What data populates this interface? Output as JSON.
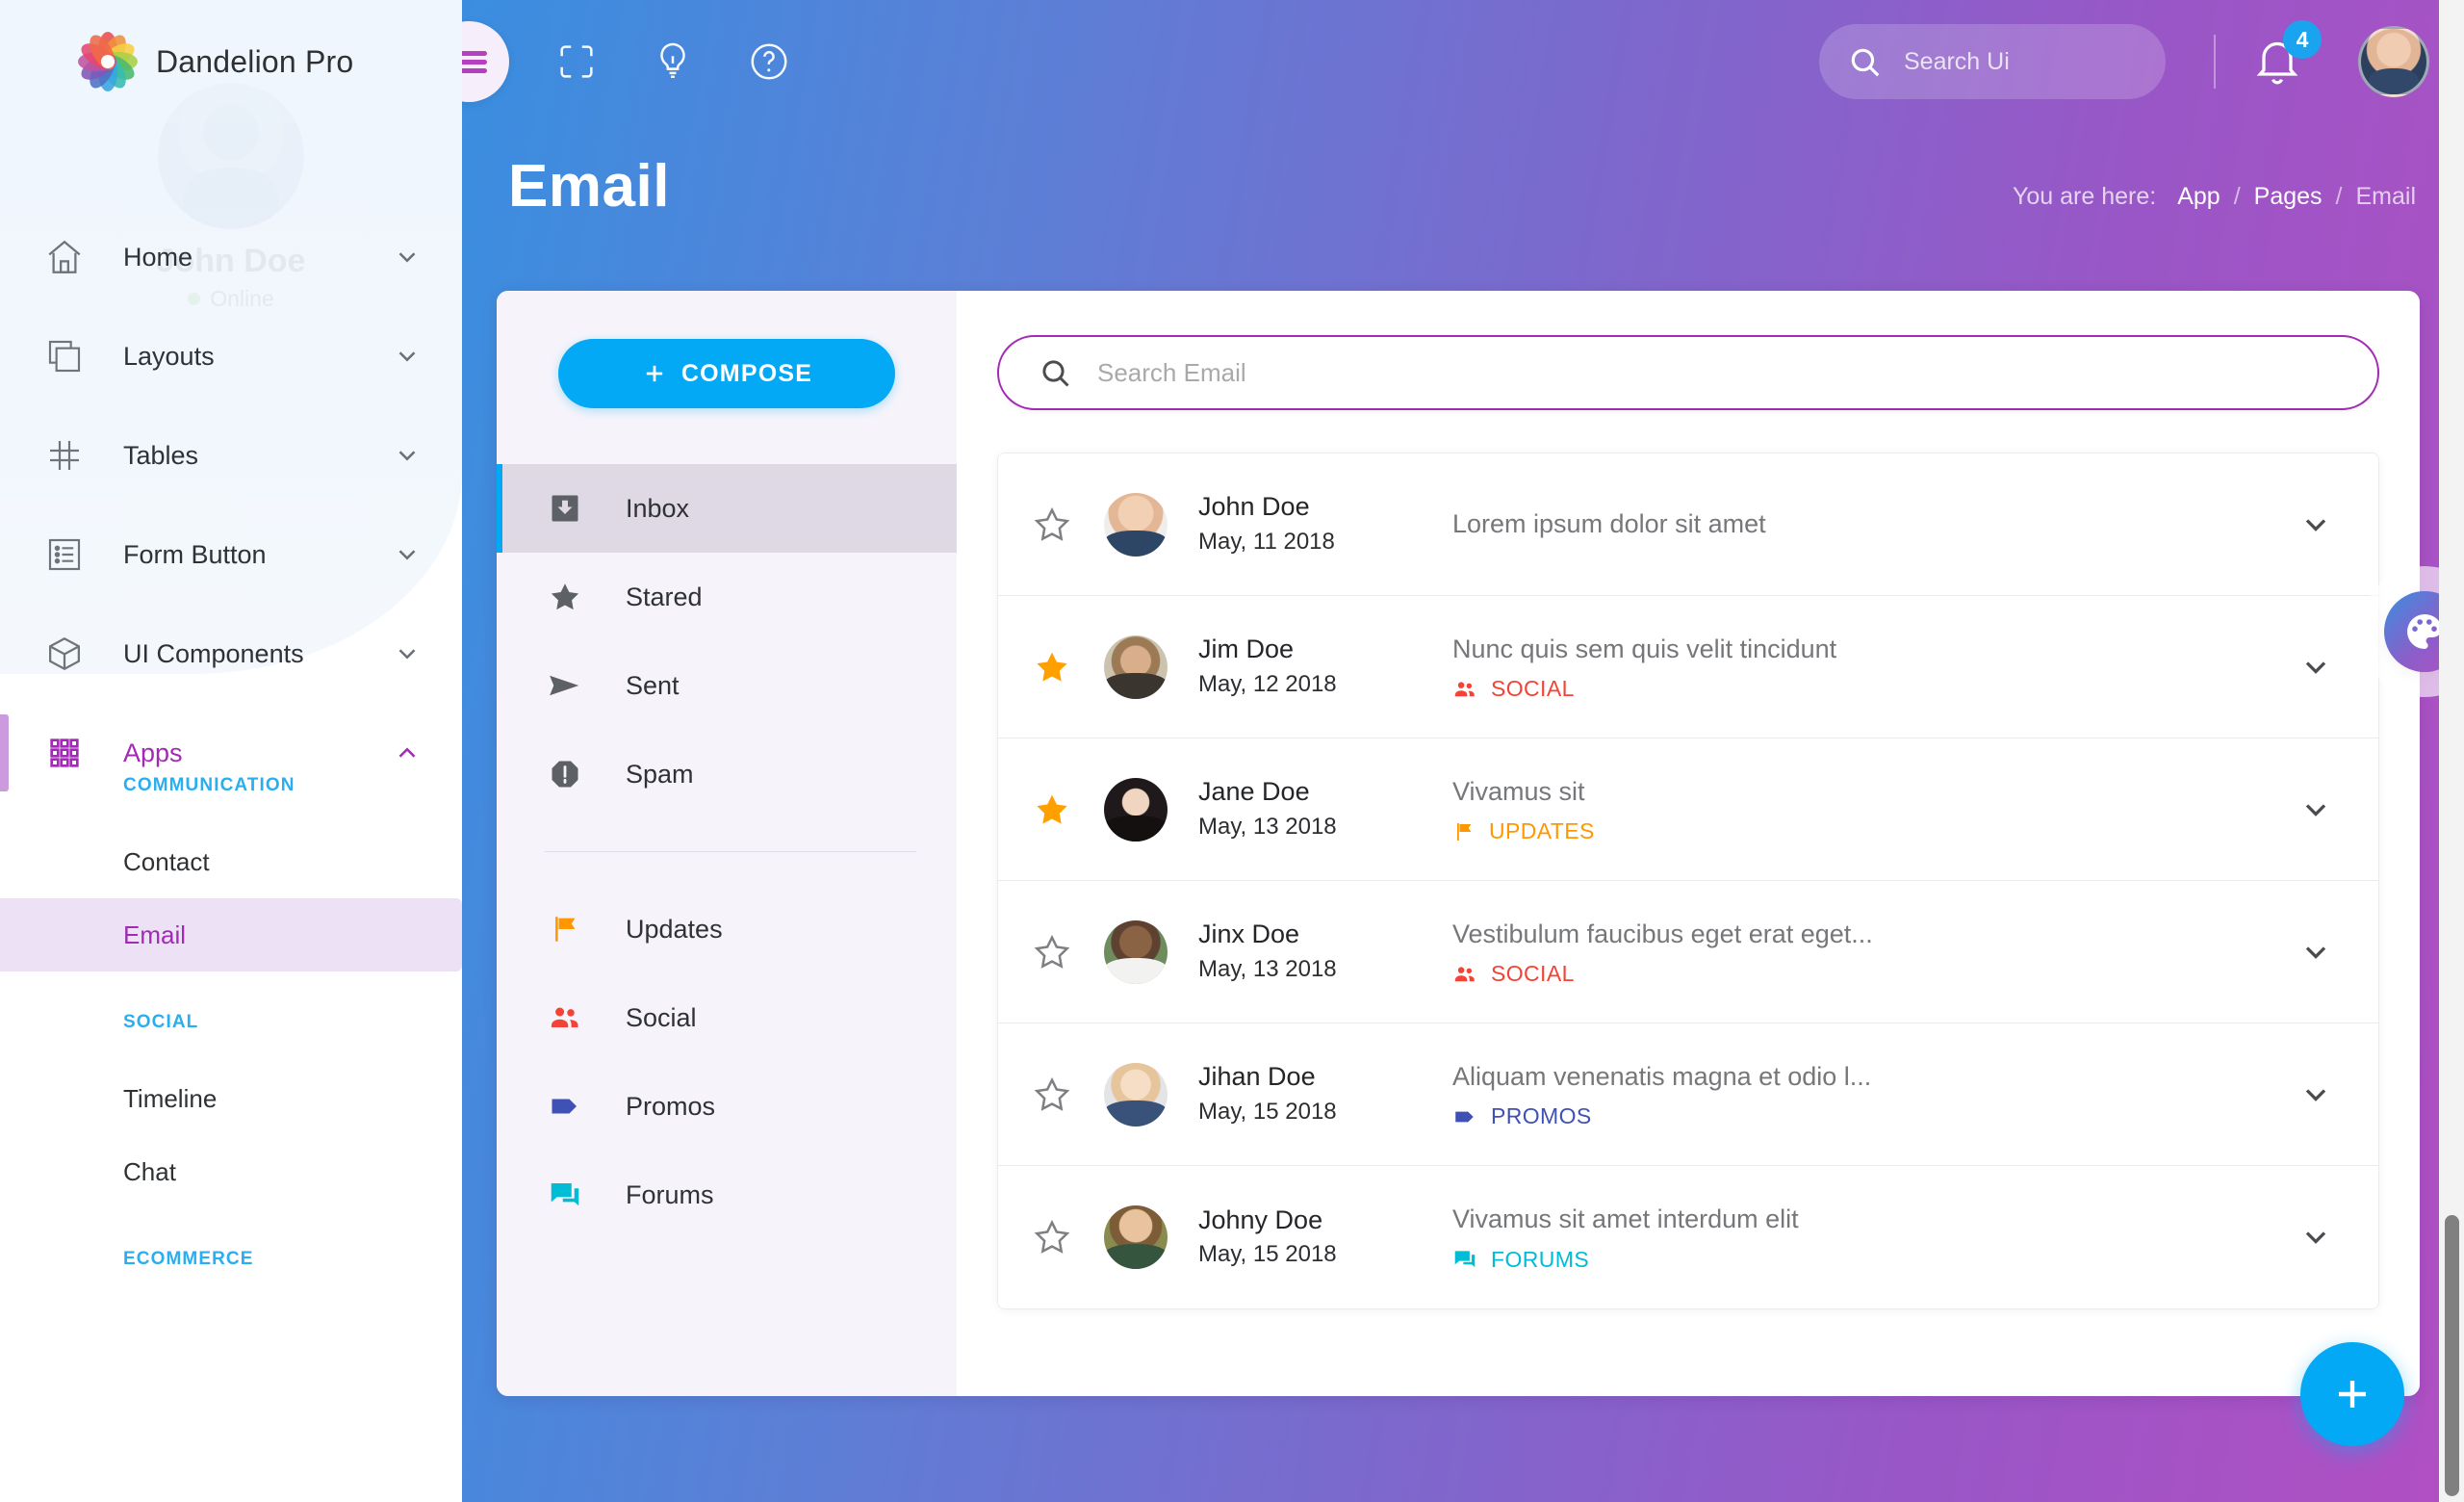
{
  "brand": {
    "name": "Dandelion Pro",
    "logo_icon": "dandelion-logo-icon"
  },
  "sidebar": {
    "profile": {
      "name": "John Doe",
      "status": "Online"
    },
    "nav": [
      {
        "label": "Home",
        "icon": "home-icon",
        "chevron": "chevron-down-icon",
        "active": false
      },
      {
        "label": "Layouts",
        "icon": "layers-icon",
        "chevron": "chevron-down-icon",
        "active": false
      },
      {
        "label": "Tables",
        "icon": "grid-hash-icon",
        "chevron": "chevron-down-icon",
        "active": false
      },
      {
        "label": "Form Button",
        "icon": "form-list-icon",
        "chevron": "chevron-down-icon",
        "active": false
      },
      {
        "label": "UI Components",
        "icon": "cube-icon",
        "chevron": "chevron-down-icon",
        "active": false
      },
      {
        "label": "Apps",
        "icon": "apps-dots-icon",
        "chevron": "chevron-up-icon",
        "active": true
      }
    ],
    "groups": [
      {
        "heading": "COMMUNICATION",
        "items": [
          {
            "label": "Contact",
            "active": false
          },
          {
            "label": "Email",
            "active": true
          }
        ]
      },
      {
        "heading": "SOCIAL",
        "items": [
          {
            "label": "Timeline",
            "active": false
          },
          {
            "label": "Chat",
            "active": false
          }
        ]
      },
      {
        "heading": "ECOMMERCE",
        "items": []
      }
    ]
  },
  "topbar": {
    "menu_icon": "hamburger-menu-icon",
    "icons": [
      {
        "name": "fullscreen-icon"
      },
      {
        "name": "lightbulb-icon"
      },
      {
        "name": "help-circle-icon"
      }
    ],
    "search": {
      "placeholder": "Search Ui",
      "value": "",
      "icon": "search-icon"
    },
    "notifications": {
      "icon": "bell-icon",
      "count": "4",
      "badge_color": "#1aa3ef"
    },
    "avatar": "user-avatar"
  },
  "page": {
    "title": "Email",
    "breadcrumb": {
      "lead": "You are here:",
      "items": [
        "App",
        "Pages",
        "Email"
      ],
      "separator": "/"
    }
  },
  "mail": {
    "compose_label": "COMPOSE",
    "compose_icon": "plus-icon",
    "folders": [
      {
        "label": "Inbox",
        "icon": "inbox-icon",
        "active": true
      },
      {
        "label": "Stared",
        "icon": "star-icon",
        "active": false
      },
      {
        "label": "Sent",
        "icon": "send-icon",
        "active": false
      },
      {
        "label": "Spam",
        "icon": "alert-octagon-icon",
        "active": false
      }
    ],
    "labels": [
      {
        "label": "Updates",
        "icon": "flag-icon",
        "color": "#ff9800"
      },
      {
        "label": "Social",
        "icon": "people-icon",
        "color": "#f44336"
      },
      {
        "label": "Promos",
        "icon": "tag-icon",
        "color": "#3f51b5"
      },
      {
        "label": "Forums",
        "icon": "forum-chat-icon",
        "color": "#00bcd4"
      }
    ],
    "search": {
      "placeholder": "Search Email",
      "value": "",
      "icon": "search-icon",
      "border_color": "#a22ab5"
    },
    "messages": [
      {
        "starred": false,
        "name": "John Doe",
        "date": "May, 11 2018",
        "subject": "Lorem ipsum dolor sit amet",
        "tag": "",
        "tag_icon": "",
        "tag_color": ""
      },
      {
        "starred": true,
        "name": "Jim Doe",
        "date": "May, 12 2018",
        "subject": "Nunc quis sem quis velit tincidunt",
        "tag": "SOCIAL",
        "tag_icon": "people-icon",
        "tag_color": "#f44336"
      },
      {
        "starred": true,
        "name": "Jane Doe",
        "date": "May, 13 2018",
        "subject": "Vivamus sit",
        "tag": "UPDATES",
        "tag_icon": "flag-icon",
        "tag_color": "#ff9800"
      },
      {
        "starred": false,
        "name": "Jinx Doe",
        "date": "May, 13 2018",
        "subject": "Vestibulum faucibus eget erat eget...",
        "tag": "SOCIAL",
        "tag_icon": "people-icon",
        "tag_color": "#f44336"
      },
      {
        "starred": false,
        "name": "Jihan Doe",
        "date": "May, 15 2018",
        "subject": "Aliquam venenatis magna et odio l...",
        "tag": "PROMOS",
        "tag_icon": "tag-icon",
        "tag_color": "#3f51b5"
      },
      {
        "starred": false,
        "name": "Johny Doe",
        "date": "May, 15 2018",
        "subject": "Vivamus sit amet interdum elit",
        "tag": "FORUMS",
        "tag_icon": "forum-chat-icon",
        "tag_color": "#00bcd4"
      }
    ]
  },
  "floating": {
    "palette_icon": "palette-icon",
    "fab_icon": "plus-icon"
  },
  "colors": {
    "accent_purple": "#a22ab5",
    "accent_blue": "#03a9f4",
    "header_gradient_start": "#3a8ee0",
    "header_gradient_end": "#b14fc4"
  }
}
